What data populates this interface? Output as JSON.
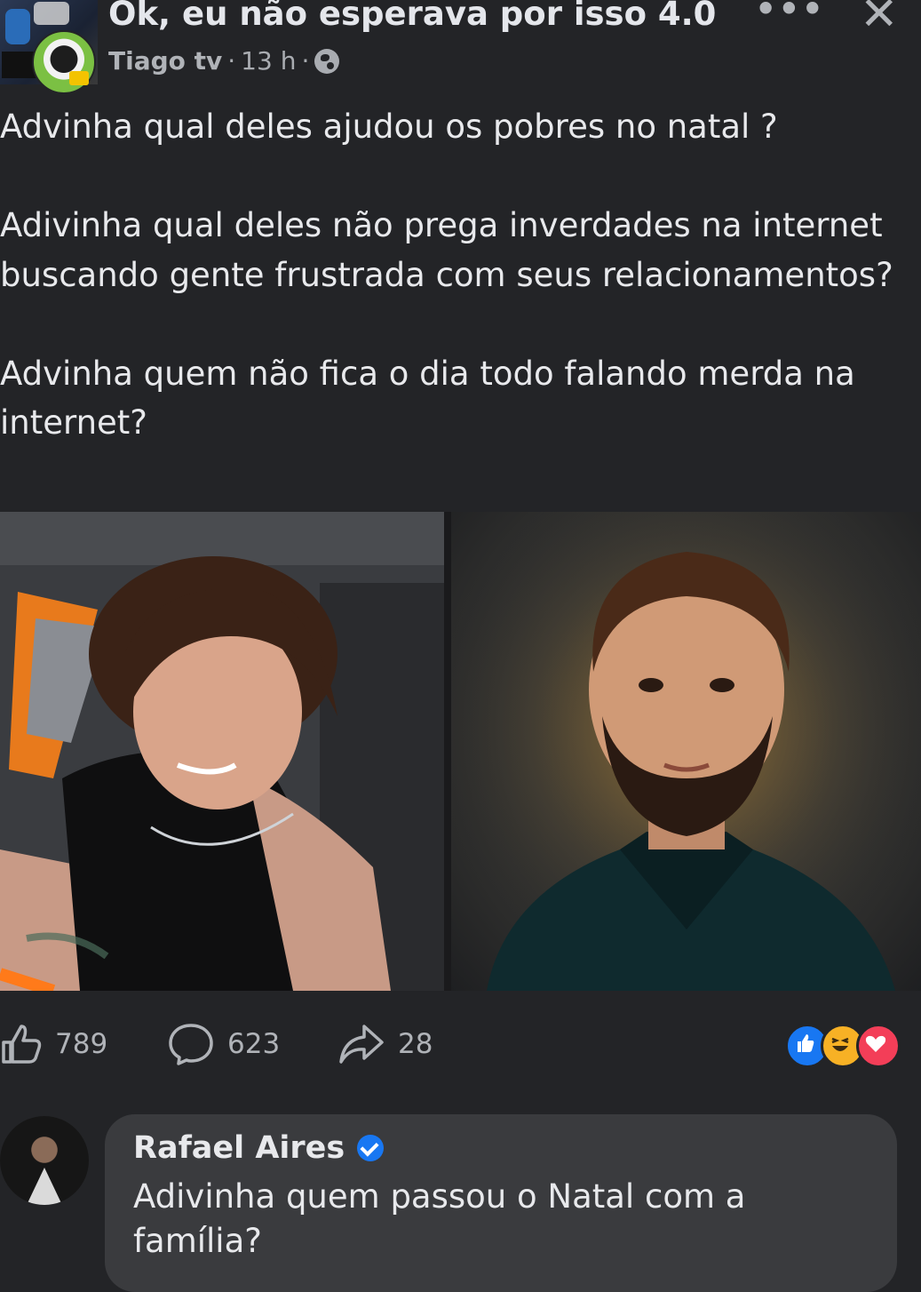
{
  "header": {
    "group_title": "Ok, eu não esperava por isso 4.0",
    "author": "Tiago tv",
    "separator": "·",
    "time": "13 h",
    "visibility_icon": "globe-icon",
    "more_icon": "ellipsis-icon",
    "close_icon": "close-icon"
  },
  "post": {
    "text": "Advinha qual deles ajudou os pobres no natal ?\n\nAdivinha qual deles não prega inverdades na internet buscando gente frustrada com seus relacionamentos?\n\nAdvinha quem não fica o dia todo falando merda na internet?"
  },
  "stats": {
    "likes": "789",
    "comments": "623",
    "shares": "28",
    "reaction_icons": [
      "like-reaction-icon",
      "haha-reaction-icon",
      "love-reaction-icon"
    ]
  },
  "comment": {
    "author": "Rafael Aires",
    "verified": true,
    "text": "Adivinha quem passou o Natal com a família?"
  },
  "colors": {
    "background": "#232427",
    "bubble": "#3a3b3e",
    "like_blue": "#1877f2",
    "haha_yellow": "#f7b125",
    "love_red": "#f33e58"
  }
}
